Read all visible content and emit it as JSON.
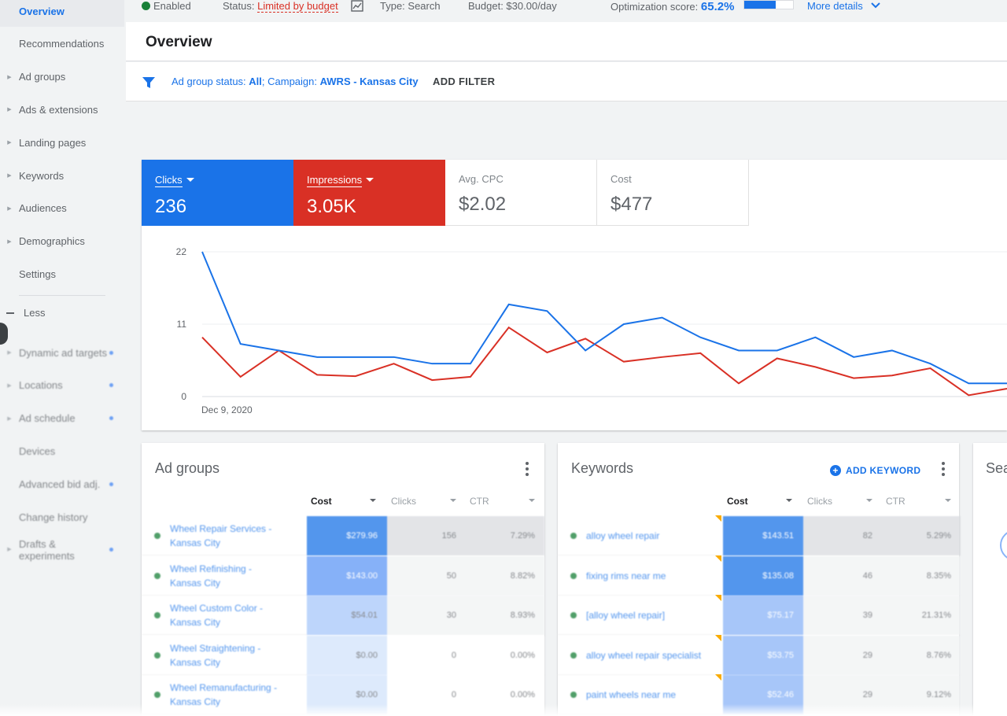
{
  "sidebar": {
    "items": [
      {
        "label": "Overview",
        "active": true,
        "expandable": false,
        "dot": false
      },
      {
        "label": "Recommendations",
        "expandable": false,
        "dot": false
      },
      {
        "label": "Ad groups",
        "expandable": true,
        "dot": false
      },
      {
        "label": "Ads & extensions",
        "expandable": true,
        "dot": false
      },
      {
        "label": "Landing pages",
        "expandable": true,
        "dot": false
      },
      {
        "label": "Keywords",
        "expandable": true,
        "dot": false
      },
      {
        "label": "Audiences",
        "expandable": true,
        "dot": false
      },
      {
        "label": "Demographics",
        "expandable": true,
        "dot": false
      },
      {
        "label": "Settings",
        "expandable": false,
        "dot": false
      }
    ],
    "less_label": "Less",
    "more_items": [
      {
        "label": "Dynamic ad targets",
        "expandable": true,
        "dot": true
      },
      {
        "label": "Locations",
        "expandable": true,
        "dot": true
      },
      {
        "label": "Ad schedule",
        "expandable": true,
        "dot": true
      },
      {
        "label": "Devices",
        "expandable": false,
        "dot": false
      },
      {
        "label": "Advanced bid adj.",
        "expandable": false,
        "dot": true
      },
      {
        "label": "Change history",
        "expandable": false,
        "dot": false
      },
      {
        "label": "Drafts & experiments",
        "expandable": true,
        "dot": true
      }
    ]
  },
  "status_bar": {
    "enabled": "Enabled",
    "status_label": "Status:",
    "status_value": "Limited by budget",
    "type": "Type: Search",
    "budget": "Budget: $30.00/day",
    "optimization_label": "Optimization score:",
    "optimization_value": "65.2%",
    "optimization_fraction": 0.652,
    "more_details": "More details"
  },
  "header": {
    "title": "Overview"
  },
  "filter": {
    "prefix": "Ad group status: ",
    "status": "All",
    "campaign_prefix": "; Campaign: ",
    "campaign": "AWRS - Kansas City",
    "add_filter": "ADD FILTER"
  },
  "metrics": [
    {
      "label": "Clicks",
      "value": "236"
    },
    {
      "label": "Impressions",
      "value": "3.05K"
    },
    {
      "label": "Avg. CPC",
      "value": "$2.02"
    },
    {
      "label": "Cost",
      "value": "$477"
    }
  ],
  "colors": {
    "blue": "#1a73e8",
    "red": "#d93025",
    "green": "#188038"
  },
  "chart_data": {
    "type": "line",
    "x_start_label": "Dec 9, 2020",
    "ylim": [
      0,
      22
    ],
    "y_ticks": [
      0,
      11,
      22
    ],
    "grid": true,
    "series": [
      {
        "values": [
          22,
          8,
          7,
          6,
          6,
          6,
          5,
          5,
          14,
          13,
          7,
          11,
          12,
          9,
          7,
          7,
          9,
          6,
          7,
          5,
          2,
          2
        ]
      },
      {
        "values": [
          9,
          3,
          7,
          3.3,
          3.1,
          5,
          2.5,
          3,
          10.5,
          6.7,
          8.8,
          5.3,
          6,
          6.6,
          2,
          5.8,
          4.5,
          2.8,
          3.2,
          4.3,
          0.2,
          1.2
        ]
      }
    ]
  },
  "ad_groups": {
    "title": "Ad groups",
    "columns": [
      "Cost",
      "Clicks",
      "CTR"
    ],
    "rows": [
      {
        "name": "Wheel Repair Services - Kansas City",
        "cost": "$279.96",
        "clicks": "156",
        "ctr": "7.29%",
        "intensity": 1.0,
        "c_shade": 2
      },
      {
        "name": "Wheel Refinishing - Kansas City",
        "cost": "$143.00",
        "clicks": "50",
        "ctr": "8.82%",
        "intensity": 0.6,
        "c_shade": 1
      },
      {
        "name": "Wheel Custom Color - Kansas City",
        "cost": "$54.01",
        "clicks": "30",
        "ctr": "8.93%",
        "intensity": 0.3,
        "c_shade": 1
      },
      {
        "name": "Wheel Straightening - Kansas City",
        "cost": "$0.00",
        "clicks": "0",
        "ctr": "0.00%",
        "intensity": 0.12,
        "c_shade": 0
      },
      {
        "name": "Wheel Remanufacturing - Kansas City",
        "cost": "$0.00",
        "clicks": "0",
        "ctr": "0.00%",
        "intensity": 0.12,
        "c_shade": 0
      }
    ]
  },
  "keywords": {
    "title": "Keywords",
    "add_label": "ADD KEYWORD",
    "columns": [
      "Cost",
      "Clicks",
      "CTR"
    ],
    "rows": [
      {
        "name": "alloy wheel repair",
        "cost": "$143.51",
        "clicks": "82",
        "ctr": "5.29%",
        "intensity": 1.0,
        "c_shade": 2
      },
      {
        "name": "fixing rims near me",
        "cost": "$135.08",
        "clicks": "46",
        "ctr": "8.35%",
        "intensity": 0.95,
        "c_shade": 1
      },
      {
        "name": "[alloy wheel repair]",
        "cost": "$75.17",
        "clicks": "39",
        "ctr": "21.31%",
        "intensity": 0.5,
        "c_shade": 1
      },
      {
        "name": "alloy wheel repair specialist",
        "cost": "$53.75",
        "clicks": "29",
        "ctr": "8.76%",
        "intensity": 0.45,
        "c_shade": 1
      },
      {
        "name": "paint wheels near me",
        "cost": "$52.46",
        "clicks": "29",
        "ctr": "9.12%",
        "intensity": 0.45,
        "c_shade": 1
      }
    ]
  },
  "search_terms": {
    "title": "Sea"
  }
}
